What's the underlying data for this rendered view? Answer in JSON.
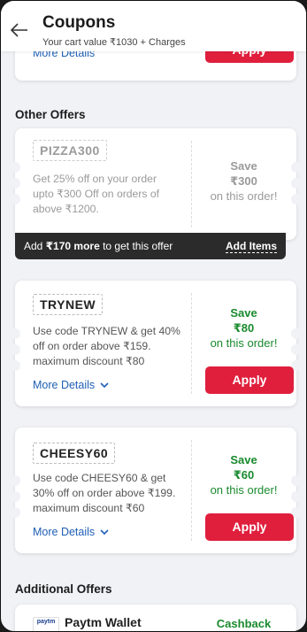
{
  "header": {
    "title": "Coupons",
    "subtitle": "Your cart value ₹1030 + Charges"
  },
  "top_card": {
    "more_details": "More Details",
    "apply_label": "Apply"
  },
  "sections": {
    "other_offers": "Other Offers",
    "additional_offers": "Additional Offers"
  },
  "offers": [
    {
      "code": "PIZZA300",
      "desc_lines": [
        "Get 25% off on your order",
        "upto ₹300 Off on orders of",
        "above ₹1200."
      ],
      "save_label": "Save",
      "save_amount": "₹300",
      "save_suffix": "on this order!",
      "locked": true,
      "unlock_prefix": "Add ",
      "unlock_amount": "₹170 more",
      "unlock_suffix": " to get this offer",
      "add_items": "Add Items"
    },
    {
      "code": "TRYNEW",
      "desc_lines": [
        "Use code TRYNEW & get 40%",
        "off on order above ₹159.",
        "maximum discount ₹80"
      ],
      "save_label": "Save",
      "save_amount": "₹80",
      "save_suffix": "on this order!",
      "more_details": "More Details",
      "apply_label": "Apply"
    },
    {
      "code": "CHEESY60",
      "desc_lines": [
        "Use code CHEESY60 & get",
        "30% off on order above ₹199.",
        "maximum discount ₹60"
      ],
      "save_label": "Save",
      "save_amount": "₹60",
      "save_suffix": "on this order!",
      "more_details": "More Details",
      "apply_label": "Apply"
    }
  ],
  "additional": {
    "logo_text": "paytm",
    "name": "Paytm Wallet",
    "right_label": "Cashback"
  },
  "colors": {
    "accent_red": "#e01f3d",
    "save_green": "#1a8a2e",
    "link_blue": "#1f5fb5",
    "locked_grey": "#9a9a9a"
  }
}
